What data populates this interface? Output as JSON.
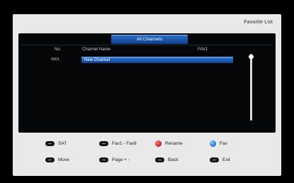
{
  "window": {
    "title": "Favorite List"
  },
  "group_tab": {
    "label": "All Channels"
  },
  "columns": {
    "no": "No.",
    "name": "Channel Name",
    "fav": "FAV1"
  },
  "channels": [
    {
      "no": "0001",
      "name": "New Channel"
    }
  ],
  "hints": {
    "sat": {
      "key_icon": "remote-button-icon",
      "label": "SAT"
    },
    "fav18": {
      "key_icon": "remote-button-icon",
      "label": "Fav1 - Fav8"
    },
    "rename": {
      "key_icon": "red-button-icon",
      "color": "#c2161a",
      "label": "Rename"
    },
    "fav": {
      "key_icon": "blue-button-icon",
      "color": "#1a66c9",
      "label": "Fav"
    },
    "move": {
      "key_icon": "remote-button-icon",
      "label": "Move"
    },
    "page": {
      "key_icon": "remote-button-icon",
      "label": "Page + -"
    },
    "back": {
      "key_icon": "remote-button-icon",
      "label": "Back"
    },
    "exit": {
      "key_icon": "remote-button-icon",
      "label": "Exit"
    }
  },
  "colors": {
    "highlight": "#2f79d4",
    "panel_bg": "#050607",
    "frame_bg": "#e9e9e9"
  }
}
